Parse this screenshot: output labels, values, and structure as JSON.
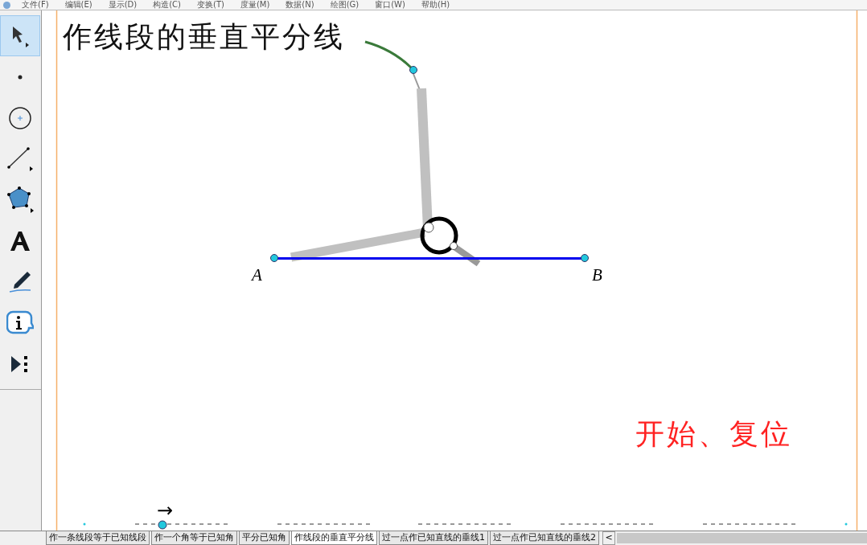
{
  "menu": [
    "文件(F)",
    "编辑(E)",
    "显示(D)",
    "构造(C)",
    "变换(T)",
    "度量(M)",
    "数据(N)",
    "绘图(G)",
    "窗口(W)",
    "帮助(H)"
  ],
  "tools": [
    {
      "kind": "arrow",
      "selected": true
    },
    {
      "kind": "point",
      "selected": false
    },
    {
      "kind": "compass",
      "selected": false
    },
    {
      "kind": "line",
      "selected": false
    },
    {
      "kind": "polygon",
      "selected": false
    },
    {
      "kind": "text",
      "selected": false
    },
    {
      "kind": "marker",
      "selected": false
    },
    {
      "kind": "info",
      "selected": false
    },
    {
      "kind": "custom",
      "selected": false
    }
  ],
  "canvas": {
    "title": "作线段的垂直平分线",
    "points": [
      {
        "label": "A"
      },
      {
        "label": "B"
      }
    ],
    "action_button": "开始、复位",
    "arrow": "→"
  },
  "tabs": [
    {
      "label": "作一条线段等于已知线段",
      "selected": false
    },
    {
      "label": "作一个角等于已知角",
      "selected": false
    },
    {
      "label": "平分已知角",
      "selected": false
    },
    {
      "label": "作线段的垂直平分线",
      "selected": true
    },
    {
      "label": "过一点作已知直线的垂线1",
      "selected": false
    },
    {
      "label": "过一点作已知直线的垂线2",
      "selected": false
    }
  ],
  "scroll_left": "<"
}
